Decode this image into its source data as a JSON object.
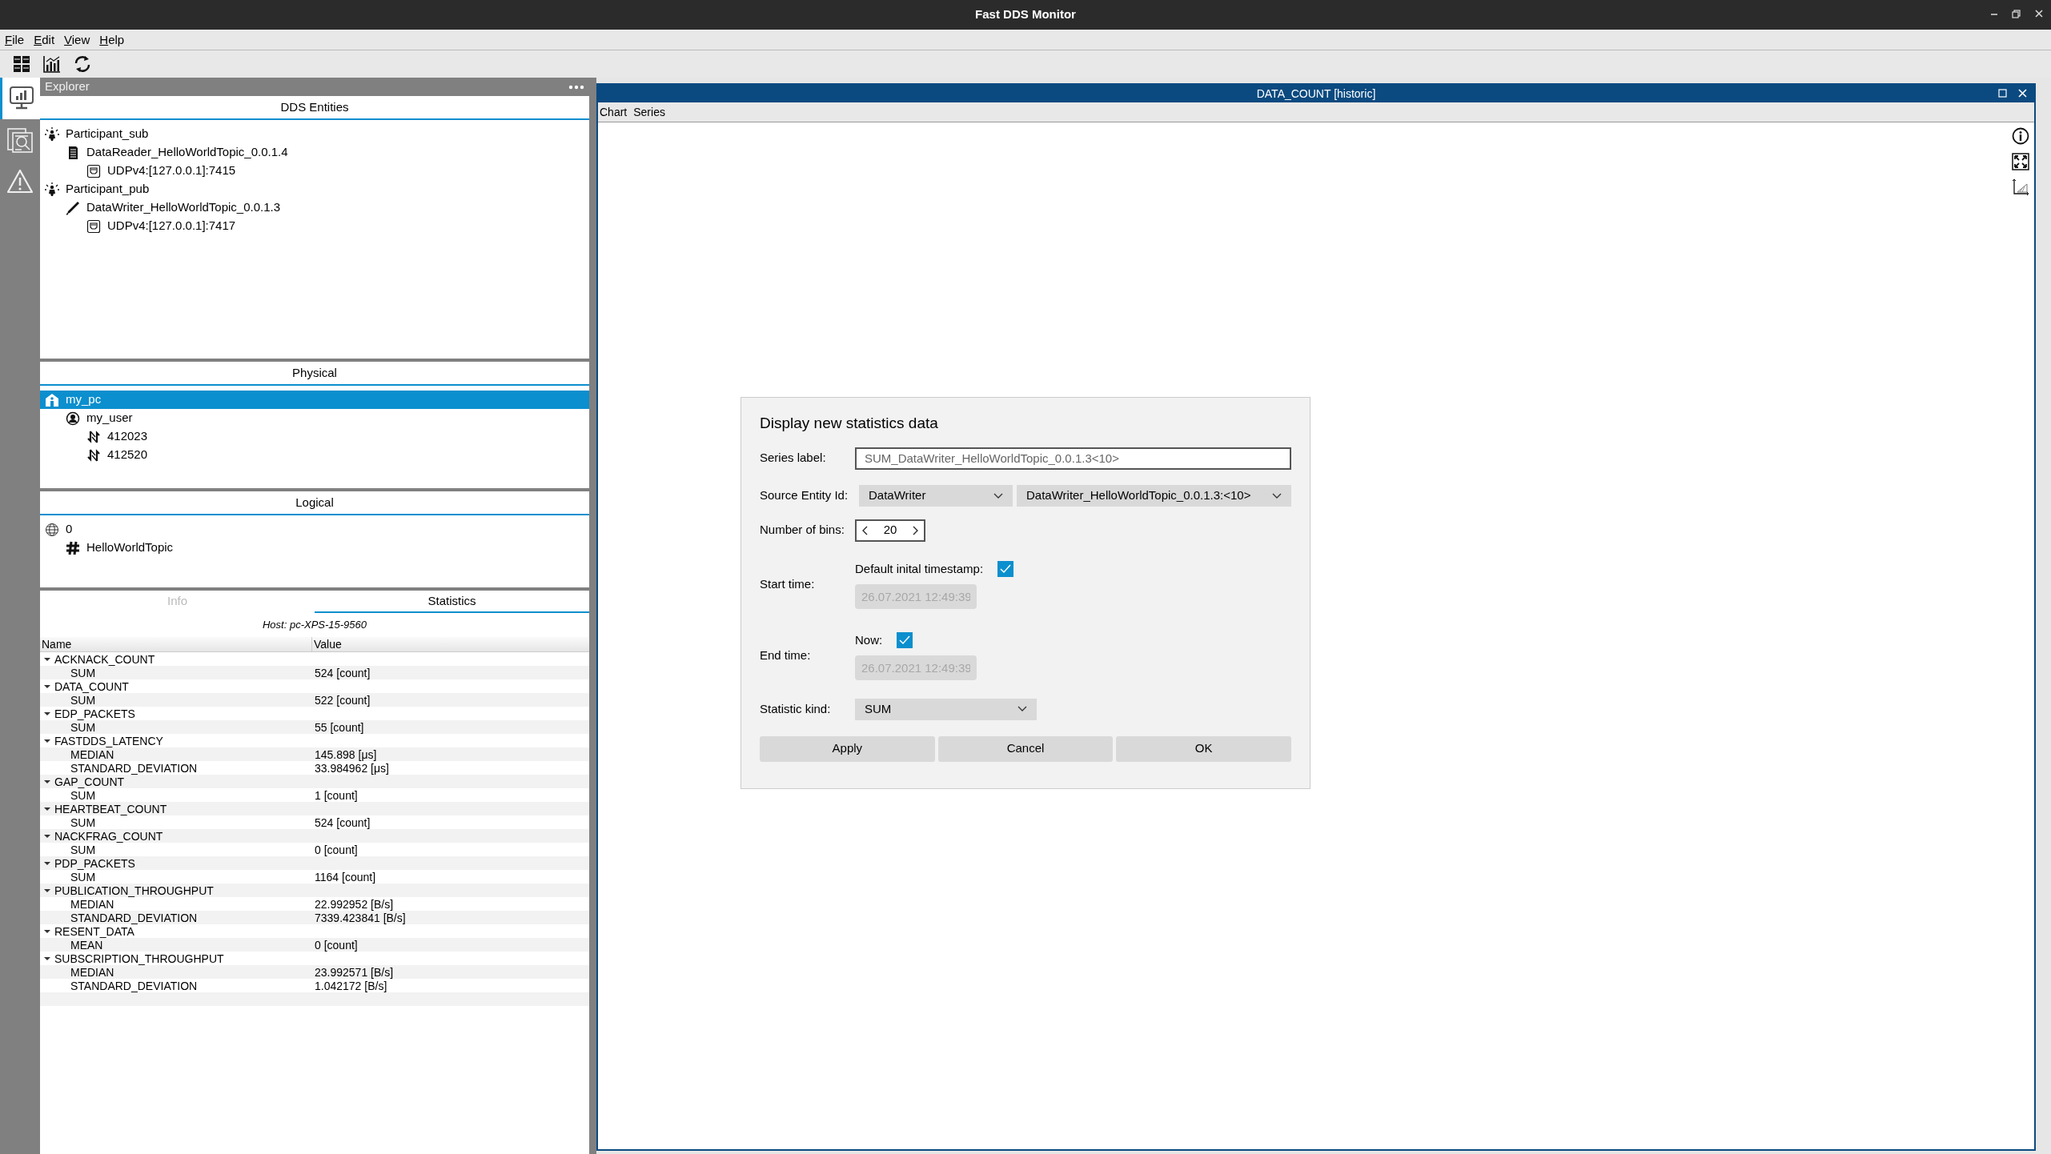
{
  "window": {
    "title": "Fast DDS Monitor"
  },
  "menu": [
    "File",
    "Edit",
    "View",
    "Help"
  ],
  "toolbar": [
    {
      "kind": "grid"
    },
    {
      "kind": "chart"
    },
    {
      "kind": "refresh"
    }
  ],
  "side_tabs": [
    {
      "kind": "monitor",
      "selected": true
    },
    {
      "kind": "search-doc",
      "selected": false
    },
    {
      "kind": "alert",
      "selected": false
    }
  ],
  "explorer": {
    "title": "Explorer",
    "panels": [
      {
        "title": "DDS Entities",
        "tree": [
          {
            "label": "Participant_sub",
            "kind": "participant",
            "selected": false,
            "children": [
              {
                "label": "DataReader_HelloWorldTopic_0.0.1.4",
                "kind": "reader",
                "selected": false,
                "children": [
                  {
                    "label": "UDPv4:[127.0.0.1]:7415",
                    "kind": "locator",
                    "selected": false
                  }
                ]
              }
            ]
          },
          {
            "label": "Participant_pub",
            "kind": "participant",
            "selected": false,
            "children": [
              {
                "label": "DataWriter_HelloWorldTopic_0.0.1.3",
                "kind": "writer",
                "selected": false,
                "children": [
                  {
                    "label": "UDPv4:[127.0.0.1]:7417",
                    "kind": "locator",
                    "selected": false
                  }
                ]
              }
            ]
          }
        ]
      },
      {
        "title": "Physical",
        "tree": [
          {
            "label": "my_pc",
            "kind": "host",
            "selected": true,
            "children": [
              {
                "label": "my_user",
                "kind": "user",
                "selected": false,
                "children": [
                  {
                    "label": "412023",
                    "kind": "process",
                    "selected": false
                  },
                  {
                    "label": "412520",
                    "kind": "process",
                    "selected": false
                  }
                ]
              }
            ]
          }
        ]
      },
      {
        "title": "Logical",
        "tree": [
          {
            "label": "0",
            "kind": "domain",
            "selected": false,
            "children": [
              {
                "label": "HelloWorldTopic",
                "kind": "topic",
                "selected": false
              }
            ]
          }
        ]
      }
    ]
  },
  "info_tabs": [
    {
      "label": "Info",
      "selected": false
    },
    {
      "label": "Statistics",
      "selected": true
    }
  ],
  "statistics": {
    "host": "Host: pc-XPS-15-9560",
    "columns": [
      "Name",
      "Value"
    ],
    "groups": [
      {
        "name": "ACKNACK_COUNT",
        "expanded": true,
        "rows": [
          {
            "name": "SUM",
            "value": "524 [count]"
          }
        ]
      },
      {
        "name": "DATA_COUNT",
        "expanded": true,
        "rows": [
          {
            "name": "SUM",
            "value": "522 [count]"
          }
        ]
      },
      {
        "name": "EDP_PACKETS",
        "expanded": true,
        "rows": [
          {
            "name": "SUM",
            "value": "55 [count]"
          }
        ]
      },
      {
        "name": "FASTDDS_LATENCY",
        "expanded": true,
        "rows": [
          {
            "name": "MEDIAN",
            "value": "145.898 [μs]"
          },
          {
            "name": "STANDARD_DEVIATION",
            "value": "33.984962 [μs]"
          }
        ]
      },
      {
        "name": "GAP_COUNT",
        "expanded": true,
        "rows": [
          {
            "name": "SUM",
            "value": "1 [count]"
          }
        ]
      },
      {
        "name": "HEARTBEAT_COUNT",
        "expanded": true,
        "rows": [
          {
            "name": "SUM",
            "value": "524 [count]"
          }
        ]
      },
      {
        "name": "NACKFRAG_COUNT",
        "expanded": true,
        "rows": [
          {
            "name": "SUM",
            "value": "0 [count]"
          }
        ]
      },
      {
        "name": "PDP_PACKETS",
        "expanded": true,
        "rows": [
          {
            "name": "SUM",
            "value": "1164 [count]"
          }
        ]
      },
      {
        "name": "PUBLICATION_THROUGHPUT",
        "expanded": true,
        "rows": [
          {
            "name": "MEDIAN",
            "value": "22.992952 [B/s]"
          },
          {
            "name": "STANDARD_DEVIATION",
            "value": "7339.423841 [B/s]"
          }
        ]
      },
      {
        "name": "RESENT_DATA",
        "expanded": true,
        "rows": [
          {
            "name": "MEAN",
            "value": "0 [count]"
          }
        ]
      },
      {
        "name": "SUBSCRIPTION_THROUGHPUT",
        "expanded": true,
        "rows": [
          {
            "name": "MEDIAN",
            "value": "23.992571 [B/s]"
          },
          {
            "name": "STANDARD_DEVIATION",
            "value": "1.042172 [B/s]"
          }
        ]
      }
    ]
  },
  "chart_window": {
    "title": "DATA_COUNT [historic]",
    "menu": [
      "Chart",
      "Series"
    ],
    "tools": [
      {
        "kind": "info"
      },
      {
        "kind": "fit"
      },
      {
        "kind": "axes"
      }
    ]
  },
  "dialog": {
    "title": "Display new statistics data",
    "series_label": {
      "label": "Series label:",
      "value": "SUM_DataWriter_HelloWorldTopic_0.0.1.3<10>"
    },
    "source_entity": {
      "label": "Source Entity Id:",
      "entity_kind": "DataWriter",
      "entity": "DataWriter_HelloWorldTopic_0.0.1.3:<10>"
    },
    "bins": {
      "label": "Number of bins:",
      "value": "20"
    },
    "times": [
      {
        "label": "Start time:",
        "checkbox_label": "Default inital timestamp:",
        "checked": true,
        "value": "26.07.2021 12:49:39",
        "disabled": true
      },
      {
        "label": "End time:",
        "checkbox_label": "Now:",
        "checked": true,
        "value": "26.07.2021 12:49:39",
        "disabled": true
      }
    ],
    "statistic_kind": {
      "label": "Statistic kind:",
      "value": "SUM"
    },
    "buttons": [
      "Apply",
      "Cancel",
      "OK"
    ]
  }
}
